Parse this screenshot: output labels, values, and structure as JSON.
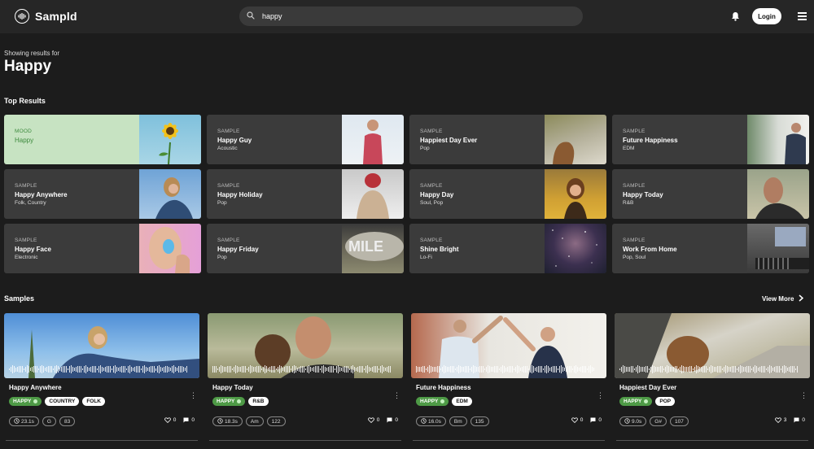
{
  "app": {
    "name": "Sampld"
  },
  "header": {
    "search_value": "happy",
    "login_label": "Login"
  },
  "results": {
    "showing_label": "Showing results for",
    "query": "Happy"
  },
  "top_results": {
    "title": "Top Results",
    "items": [
      {
        "type": "MOOD",
        "name": "Happy",
        "genre": ""
      },
      {
        "type": "SAMPLE",
        "name": "Happy Guy",
        "genre": "Acoustic"
      },
      {
        "type": "SAMPLE",
        "name": "Happiest Day Ever",
        "genre": "Pop"
      },
      {
        "type": "SAMPLE",
        "name": "Future Happiness",
        "genre": "EDM"
      },
      {
        "type": "SAMPLE",
        "name": "Happy Anywhere",
        "genre": "Folk, Country"
      },
      {
        "type": "SAMPLE",
        "name": "Happy Holiday",
        "genre": "Pop"
      },
      {
        "type": "SAMPLE",
        "name": "Happy Day",
        "genre": "Soul, Pop"
      },
      {
        "type": "SAMPLE",
        "name": "Happy Today",
        "genre": "R&B"
      },
      {
        "type": "SAMPLE",
        "name": "Happy Face",
        "genre": "Electronic"
      },
      {
        "type": "SAMPLE",
        "name": "Happy Friday",
        "genre": "Pop"
      },
      {
        "type": "SAMPLE",
        "name": "Shine Bright",
        "genre": "Lo-Fi"
      },
      {
        "type": "SAMPLE",
        "name": "Work From Home",
        "genre": "Pop, Soul"
      }
    ]
  },
  "samples": {
    "title": "Samples",
    "view_more": "View More",
    "items": [
      {
        "title": "Happy Anywhere",
        "mood": "HAPPY",
        "genres": [
          "COUNTRY",
          "FOLK"
        ],
        "duration": "23.1s",
        "key": "G",
        "bpm": "83",
        "likes": "0",
        "comments": "0"
      },
      {
        "title": "Happy Today",
        "mood": "HAPPY",
        "genres": [
          "R&B"
        ],
        "duration": "18.3s",
        "key": "Am",
        "bpm": "122",
        "likes": "0",
        "comments": "0"
      },
      {
        "title": "Future Happiness",
        "mood": "HAPPY",
        "genres": [
          "EDM"
        ],
        "duration": "16.0s",
        "key": "Bm",
        "bpm": "135",
        "likes": "0",
        "comments": "0"
      },
      {
        "title": "Happiest Day Ever",
        "mood": "HAPPY",
        "genres": [
          "POP"
        ],
        "duration": "9.0s",
        "key": "G#",
        "bpm": "107",
        "likes": "3",
        "comments": "0"
      }
    ]
  },
  "icons": [
    "logo-icon",
    "search-icon",
    "bell-icon",
    "menu-icon",
    "chevron-right-icon",
    "more-vertical-icon",
    "clock-icon",
    "heart-icon",
    "comment-icon"
  ],
  "colors": {
    "background": "#1c1c1c",
    "header": "#262626",
    "card": "#3b3b3b",
    "mood_green": "#4e9a46",
    "mood_card": "#c7e3c2"
  }
}
